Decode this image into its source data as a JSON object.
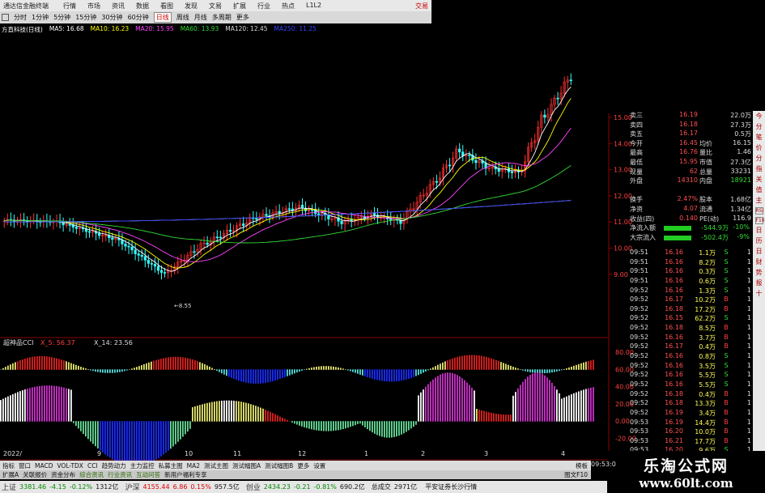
{
  "window": {
    "title": "通达信金融终端",
    "menu": [
      "行情",
      "市场",
      "资讯",
      "数据",
      "看图",
      "发现",
      "文易",
      "扩展",
      "行业",
      "热点",
      "L1L2"
    ],
    "trade": "交易"
  },
  "toolbar": {
    "icon": "grid-icon",
    "periods": [
      "分时",
      "1分钟",
      "5分钟",
      "15分钟",
      "30分钟",
      "60分钟",
      "日线",
      "周线",
      "月线",
      "多周期",
      "更多"
    ],
    "selected": "日线"
  },
  "stock": {
    "name": "方直科技(日线)"
  },
  "ma_legend": [
    {
      "label": "MA5: 16.68",
      "color": "#ffffff"
    },
    {
      "label": "MA10: 16.23",
      "color": "#ffff00"
    },
    {
      "label": "MA20: 15.95",
      "color": "#ff44ff"
    },
    {
      "label": "MA60: 13.93",
      "color": "#33dd33"
    },
    {
      "label": "MA120: 12.45",
      "color": "#dddddd"
    },
    {
      "label": "MA250: 11.25",
      "color": "#3344ff"
    }
  ],
  "price_axis": [
    "15.00",
    "14.00",
    "13.00",
    "12.00",
    "11.00",
    "10.00",
    "9.00"
  ],
  "low_label": "8.55",
  "indicator": {
    "name": "超神品CCI",
    "p1": "X_5: 56.37",
    "p2": "X_14: 23.56"
  },
  "ind_axis": [
    "80.00",
    "60.00",
    "40.00",
    "20.00",
    "0.00",
    "-20.00",
    "-40.00"
  ],
  "dates": [
    "2022/",
    "9",
    "10",
    "11",
    "12",
    "1",
    "2",
    "3",
    "4"
  ],
  "quote_top": [
    {
      "k": "卖三",
      "v": "16.19",
      "v2": "",
      "n": "22.0万"
    },
    {
      "k": "卖四",
      "v": "16.18",
      "v2": "",
      "n": "27.3万"
    },
    {
      "k": "卖五",
      "v": "16.17",
      "v2": "",
      "n": "0.5万"
    },
    {
      "k": "今开",
      "v": "16.45",
      "k2": "均价",
      "n": "16.15"
    },
    {
      "k": "最高",
      "v": "16.76",
      "k2": "量比",
      "n": "1.46"
    },
    {
      "k": "最低",
      "v": "15.95",
      "k2": "市值",
      "n": "27.3亿"
    },
    {
      "k": "现量",
      "v": "62",
      "k2": "总量",
      "n": "33231"
    },
    {
      "k": "外盘",
      "v": "14310",
      "k2": "内盘",
      "n": "18921"
    },
    {
      "k": "",
      "v": "",
      "k2": "",
      "n": ""
    },
    {
      "k": "换手",
      "v": "2.47%",
      "k2": "股本",
      "n": "1.68亿"
    },
    {
      "k": "净资",
      "v": "4.07",
      "k2": "流通",
      "n": "1.34亿"
    },
    {
      "k": "收益(四)",
      "v": "0.140",
      "k2": "PE(动)",
      "n": "116.9"
    }
  ],
  "flows": [
    {
      "k": "净流入额",
      "v": "-544.9万",
      "p": "-10%"
    },
    {
      "k": "大宗流入",
      "v": "-502.4万",
      "p": "-9%"
    }
  ],
  "ticks": [
    {
      "t": "09:51",
      "p": "16.16",
      "v": "1.1万",
      "s": "S",
      "n": "1"
    },
    {
      "t": "09:51",
      "p": "16.16",
      "v": "8.2万",
      "s": "S",
      "n": "1"
    },
    {
      "t": "09:51",
      "p": "16.16",
      "v": "0.3万",
      "s": "S",
      "n": "1"
    },
    {
      "t": "09:51",
      "p": "16.16",
      "v": "0.6万",
      "s": "S",
      "n": "1"
    },
    {
      "t": "09:52",
      "p": "16.16",
      "v": "1.3万",
      "s": "S",
      "n": "1"
    },
    {
      "t": "09:52",
      "p": "16.17",
      "v": "10.2万",
      "s": "B",
      "n": "1"
    },
    {
      "t": "09:52",
      "p": "16.18",
      "v": "17.2万",
      "s": "B",
      "n": "1"
    },
    {
      "t": "09:52",
      "p": "16.15",
      "v": "62.2万",
      "s": "S",
      "n": "1"
    },
    {
      "t": "09:52",
      "p": "16.18",
      "v": "8.5万",
      "s": "B",
      "n": "1"
    },
    {
      "t": "09:52",
      "p": "16.16",
      "v": "3.7万",
      "s": "B",
      "n": "1"
    },
    {
      "t": "09:52",
      "p": "16.17",
      "v": "0.4万",
      "s": "B",
      "n": "1"
    },
    {
      "t": "09:52",
      "p": "16.16",
      "v": "0.8万",
      "s": "S",
      "n": "1"
    },
    {
      "t": "09:52",
      "p": "16.16",
      "v": "3.5万",
      "s": "S",
      "n": "1"
    },
    {
      "t": "09:52",
      "p": "16.16",
      "v": "5.5万",
      "s": "S",
      "n": "1"
    },
    {
      "t": "09:52",
      "p": "16.16",
      "v": "5.5万",
      "s": "S",
      "n": "1"
    },
    {
      "t": "09:52",
      "p": "16.18",
      "v": "0.4万",
      "s": "B",
      "n": "1"
    },
    {
      "t": "09:52",
      "p": "16.18",
      "v": "13.3万",
      "s": "B",
      "n": "1"
    },
    {
      "t": "09:52",
      "p": "16.19",
      "v": "3.4万",
      "s": "B",
      "n": "1"
    },
    {
      "t": "09:53",
      "p": "16.19",
      "v": "14.4万",
      "s": "B",
      "n": "1"
    },
    {
      "t": "09:53",
      "p": "16.20",
      "v": "10.0万",
      "s": "B",
      "n": "1"
    },
    {
      "t": "09:53",
      "p": "16.21",
      "v": "17.7万",
      "s": "B",
      "n": "1"
    },
    {
      "t": "09:53",
      "p": "16.20",
      "v": "9.6万",
      "s": "S",
      "n": "1"
    }
  ],
  "side_tabs": [
    "今",
    "分",
    "笔",
    "价",
    "分",
    "指",
    "关",
    "值",
    "主",
    "RSI",
    "F10",
    "日",
    "历",
    "日",
    "财",
    "势",
    "报",
    "十"
  ],
  "ind_tabs": [
    "指标",
    "窗口",
    "MACD",
    "VOL-TDX",
    "CCI",
    "趋势动力",
    "主力监控",
    "私募主图",
    "MA2",
    "测试主图",
    "测试幅图A",
    "测试幅图B",
    "更多",
    "设置"
  ],
  "ind_tabs_right": "模板",
  "sub_tabs": [
    "扩展A",
    "关联报价",
    "资金分布",
    "综合资讯",
    "行业资讯",
    "互动问答",
    "新用户福利专享"
  ],
  "sub_tabs_right": "图文F10",
  "status": [
    {
      "name": "上证",
      "v": "3381.46",
      "c": "-4.15",
      "p": "-0.12%",
      "a": "1312亿"
    },
    {
      "name": "沪深",
      "v": "4155.44",
      "c": "6.86",
      "p": "0.15%",
      "a": "957.5亿"
    },
    {
      "name": "创业",
      "v": "2434.23",
      "c": "-0.21",
      "p": "-0.81%",
      "a": "690.2亿"
    }
  ],
  "status_total_label": "总成交",
  "status_total": "2971亿",
  "status_broker": "平安证券长沙行情",
  "clock": "09:53:0",
  "watermark": {
    "line1": "乐淘公式网",
    "line2": "www.60lt.com"
  },
  "chart_colors": {
    "up": "#ff3030",
    "down": "#33ffff",
    "cyan_bar": "#55dddd",
    "blue_bar": "#1a2cff",
    "red_bar": "#e02020",
    "yellow_bar": "#e8e870",
    "magenta_bar": "#cc33cc",
    "green_bar": "#66dd99",
    "white_bar": "#ffffff"
  }
}
